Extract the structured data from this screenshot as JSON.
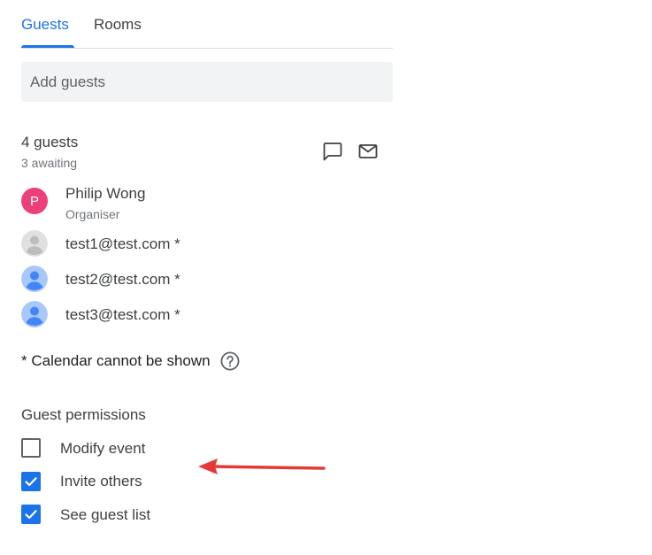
{
  "tabs": [
    {
      "label": "Guests",
      "active": true
    },
    {
      "label": "Rooms",
      "active": false
    }
  ],
  "add_guests": {
    "placeholder": "Add guests",
    "value": ""
  },
  "summary": {
    "count": "4 guests",
    "awaiting": "3 awaiting",
    "icons": [
      "chat-icon",
      "email-icon"
    ]
  },
  "guests": [
    {
      "name": "Philip Wong",
      "role": "Organiser",
      "initial": "P",
      "avatar_color": "#ec407a"
    },
    {
      "name": "test1@test.com *",
      "avatar": "default-grey"
    },
    {
      "name": "test2@test.com *",
      "avatar": "default-blue"
    },
    {
      "name": "test3@test.com *",
      "avatar": "default-blue"
    }
  ],
  "calendar_note": "* Calendar cannot be shown",
  "permissions": {
    "heading": "Guest permissions",
    "items": [
      {
        "label": "Modify event",
        "checked": false
      },
      {
        "label": "Invite others",
        "checked": true
      },
      {
        "label": "See guest list",
        "checked": true
      }
    ]
  },
  "colors": {
    "accent": "#1a73e8",
    "annotation_arrow": "#e53935",
    "input_bg": "#f1f3f4"
  }
}
